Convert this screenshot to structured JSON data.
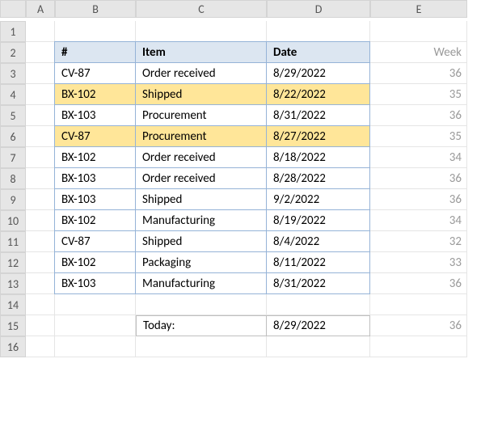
{
  "columns": [
    "A",
    "B",
    "C",
    "D",
    "E"
  ],
  "row_count": 16,
  "table": {
    "headers": {
      "num": "#",
      "item": "Item",
      "date": "Date"
    },
    "week_label": "Week",
    "rows": [
      {
        "num": "CV-87",
        "item": "Order received",
        "date": "8/29/2022",
        "week": "36",
        "highlight": false
      },
      {
        "num": "BX-102",
        "item": "Shipped",
        "date": "8/22/2022",
        "week": "35",
        "highlight": true
      },
      {
        "num": "BX-103",
        "item": "Procurement",
        "date": "8/31/2022",
        "week": "36",
        "highlight": false
      },
      {
        "num": "CV-87",
        "item": "Procurement",
        "date": "8/27/2022",
        "week": "35",
        "highlight": true
      },
      {
        "num": "BX-102",
        "item": "Order received",
        "date": "8/18/2022",
        "week": "34",
        "highlight": false
      },
      {
        "num": "BX-103",
        "item": "Order received",
        "date": "8/28/2022",
        "week": "36",
        "highlight": false
      },
      {
        "num": "BX-103",
        "item": "Shipped",
        "date": "9/2/2022",
        "week": "36",
        "highlight": false
      },
      {
        "num": "BX-102",
        "item": "Manufacturing",
        "date": "8/19/2022",
        "week": "34",
        "highlight": false
      },
      {
        "num": "CV-87",
        "item": "Shipped",
        "date": "8/4/2022",
        "week": "32",
        "highlight": false
      },
      {
        "num": "BX-102",
        "item": "Packaging",
        "date": "8/11/2022",
        "week": "33",
        "highlight": false
      },
      {
        "num": "BX-103",
        "item": "Manufacturing",
        "date": "8/31/2022",
        "week": "36",
        "highlight": false
      }
    ]
  },
  "today": {
    "label": "Today:",
    "date": "8/29/2022",
    "week": "36"
  }
}
